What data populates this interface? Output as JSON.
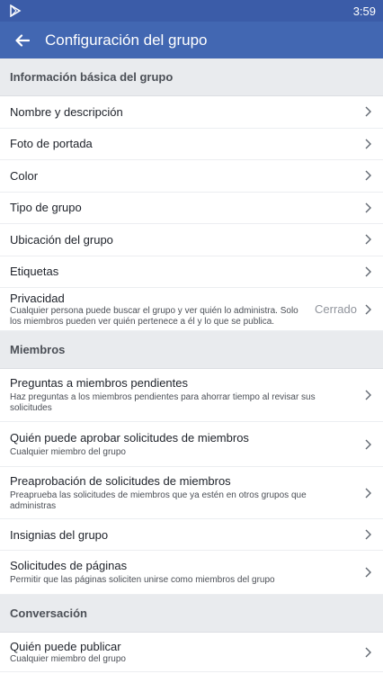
{
  "status_bar": {
    "time": "3:59"
  },
  "app_bar": {
    "title": "Configuración del grupo"
  },
  "sections": {
    "basic": {
      "header": "Información básica del grupo",
      "items": [
        {
          "label": "Nombre y descripción"
        },
        {
          "label": "Foto de portada"
        },
        {
          "label": "Color"
        },
        {
          "label": "Tipo de grupo"
        },
        {
          "label": "Ubicación del grupo"
        },
        {
          "label": "Etiquetas"
        },
        {
          "label": "Privacidad",
          "subtitle": "Cualquier persona puede buscar el grupo y ver quién lo administra. Solo los miembros pueden ver quién pertenece a él y lo que se publica.",
          "value": "Cerrado"
        }
      ]
    },
    "members": {
      "header": "Miembros",
      "items": [
        {
          "label": "Preguntas a miembros pendientes",
          "subtitle": "Haz preguntas a los miembros pendientes para ahorrar tiempo al revisar sus solicitudes"
        },
        {
          "label": "Quién puede aprobar solicitudes de miembros",
          "subtitle": "Cualquier miembro del grupo"
        },
        {
          "label": "Preaprobación de solicitudes de miembros",
          "subtitle": "Preaprueba las solicitudes de miembros que ya estén en otros grupos que administras"
        },
        {
          "label": "Insignias del grupo"
        },
        {
          "label": "Solicitudes de páginas",
          "subtitle": "Permitir que las páginas soliciten unirse como miembros del grupo"
        }
      ]
    },
    "conversation": {
      "header": "Conversación",
      "items": [
        {
          "label": "Quién puede publicar",
          "subtitle": "Cualquier miembro del grupo"
        }
      ]
    }
  },
  "colors": {
    "app_bar": "#4267b2",
    "status_bar": "#3b5ca8",
    "section_bg": "#e9ebee"
  }
}
